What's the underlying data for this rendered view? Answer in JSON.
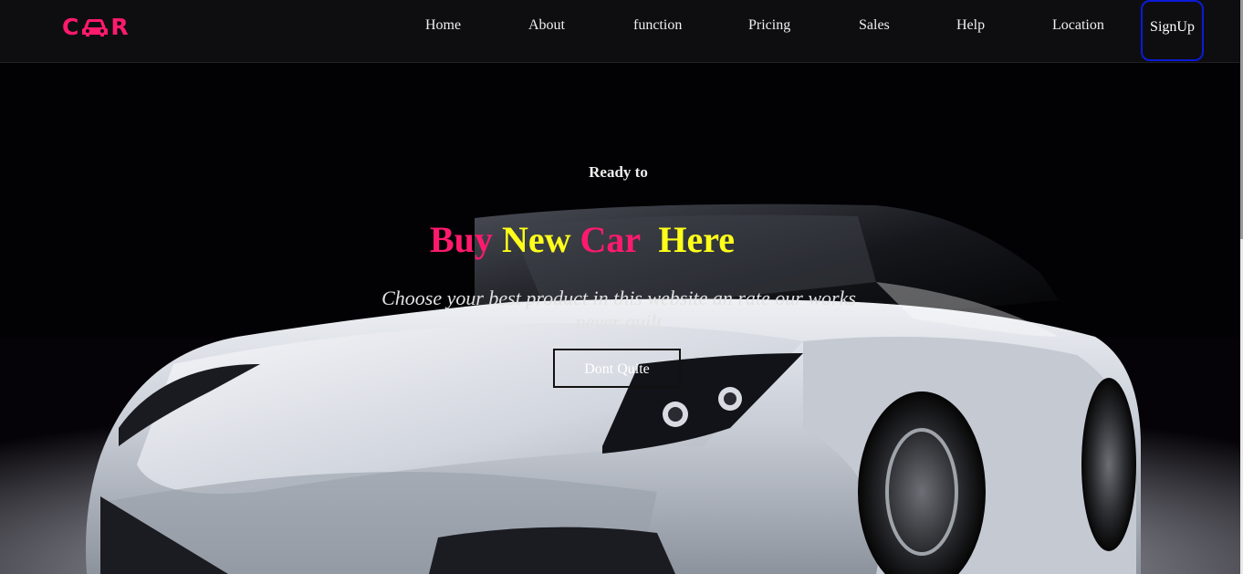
{
  "brand": {
    "letters": [
      "C",
      "A",
      "R"
    ],
    "color": "#ff1a6e",
    "icon": "car-icon"
  },
  "nav": {
    "items": [
      "Home",
      "About",
      "function",
      "Pricing",
      "Sales",
      "Help",
      "Location"
    ],
    "signup_label": "SignUp",
    "signup_border_color": "#0b1bd6"
  },
  "hero": {
    "kicker": "Ready to",
    "headline": [
      {
        "text": "Buy",
        "color": "#ff1a6e"
      },
      {
        "text": "New",
        "color": "#ffff1a"
      },
      {
        "text": "Car",
        "color": "#ff1a6e"
      },
      {
        "text": "Here",
        "color": "#ffff1a"
      }
    ],
    "tagline": "Choose your best product in this website an rate our works never quilt",
    "cta_label": "Dont Quite",
    "background": "white-sports-car-photo"
  }
}
